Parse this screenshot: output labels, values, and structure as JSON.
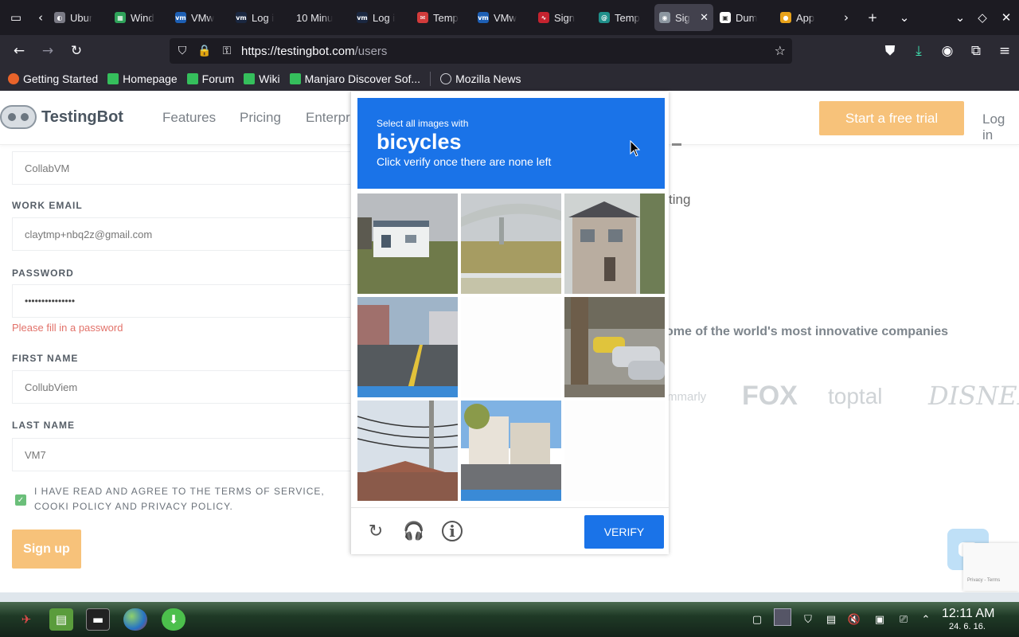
{
  "browser": {
    "tabs": [
      {
        "title": "Ubur",
        "favicon": "ubuntu-icon",
        "color": "#7a7a85",
        "glyph": "◐"
      },
      {
        "title": "Wind",
        "favicon": "sheet-icon",
        "color": "#2fa35a",
        "glyph": "▦"
      },
      {
        "title": "VMw",
        "favicon": "vmware-icon",
        "color": "#1d5fb4",
        "glyph": "vm"
      },
      {
        "title": "Log i",
        "favicon": "vmware-icon",
        "color": "#1a2740",
        "glyph": "vm"
      },
      {
        "title": "10 Minu",
        "favicon": "none",
        "color": "",
        "glyph": ""
      },
      {
        "title": "Log i",
        "favicon": "vmware-icon",
        "color": "#1a2740",
        "glyph": "vm"
      },
      {
        "title": "Temp",
        "favicon": "mail-icon",
        "color": "#d23b3b",
        "glyph": "✉"
      },
      {
        "title": "VMw",
        "favicon": "vmware-icon",
        "color": "#1d5fb4",
        "glyph": "vm"
      },
      {
        "title": "Sign",
        "favicon": "pulse-icon",
        "color": "#c5232f",
        "glyph": "∿"
      },
      {
        "title": "Temp",
        "favicon": "temp-icon",
        "color": "#1f8f8a",
        "glyph": "@"
      },
      {
        "title": "Sig",
        "favicon": "testingbot-icon",
        "color": "#8c96a0",
        "glyph": "◉",
        "active": true
      },
      {
        "title": "Dum",
        "favicon": "dummy-icon",
        "color": "#ffffff",
        "glyph": "▣"
      },
      {
        "title": "App",
        "favicon": "chrome-icon",
        "color": "#e8a21a",
        "glyph": "●"
      }
    ],
    "url_host": "https://testingbot.com",
    "url_path": "/users",
    "bookmarks": [
      {
        "label": "Getting Started",
        "color": "#e8632a"
      },
      {
        "label": "Homepage",
        "color": "#35bf5c"
      },
      {
        "label": "Forum",
        "color": "#35bf5c"
      },
      {
        "label": "Wiki",
        "color": "#35bf5c"
      },
      {
        "label": "Manjaro Discover Sof...",
        "color": "#35bf5c"
      },
      {
        "label": "Mozilla News",
        "color": "#cfd0d6"
      }
    ]
  },
  "site": {
    "brand": "TestingBot",
    "nav": [
      "Features",
      "Pricing",
      "Enterpr"
    ],
    "cta": "Start a free trial",
    "login": "Log in",
    "form": {
      "company_value": "CollabVM",
      "email_label": "WORK EMAIL",
      "email_value": "claytmp+nbq2z@gmail.com",
      "password_label": "PASSWORD",
      "password_value": "•••••••••••••••",
      "password_error": "Please fill in a password",
      "first_label": "FIRST NAME",
      "first_value": "CollubViem",
      "last_label": "LAST NAME",
      "last_value": "VM7",
      "terms": "I HAVE READ AND AGREE TO THE TERMS OF SERVICE, COOKI POLICY AND PRIVACY POLICY.",
      "signup": "Sign up"
    },
    "hero_fragment": "ting",
    "trusted": "ome of the world's most innovative companies",
    "logos": [
      "mmarly",
      "FOX",
      "toptal",
      "DISNEP"
    ],
    "recaptcha_badge": "Privacy - Terms"
  },
  "captcha": {
    "pre": "Select all images with",
    "object": "bicycles",
    "post": "Click verify once there are none left",
    "verify": "VERIFY",
    "tiles": [
      {
        "name": "tile-building-field",
        "scene": "building"
      },
      {
        "name": "tile-overpass",
        "scene": "overpass"
      },
      {
        "name": "tile-house",
        "scene": "house"
      },
      {
        "name": "tile-street",
        "scene": "street"
      },
      {
        "name": "tile-empty",
        "scene": "empty"
      },
      {
        "name": "tile-parked-cars",
        "scene": "cars"
      },
      {
        "name": "tile-power-lines",
        "scene": "wires"
      },
      {
        "name": "tile-residential",
        "scene": "residential"
      },
      {
        "name": "tile-empty-2",
        "scene": "empty"
      }
    ]
  },
  "taskbar": {
    "time": "12:11 AM",
    "date": "24. 6. 16."
  }
}
